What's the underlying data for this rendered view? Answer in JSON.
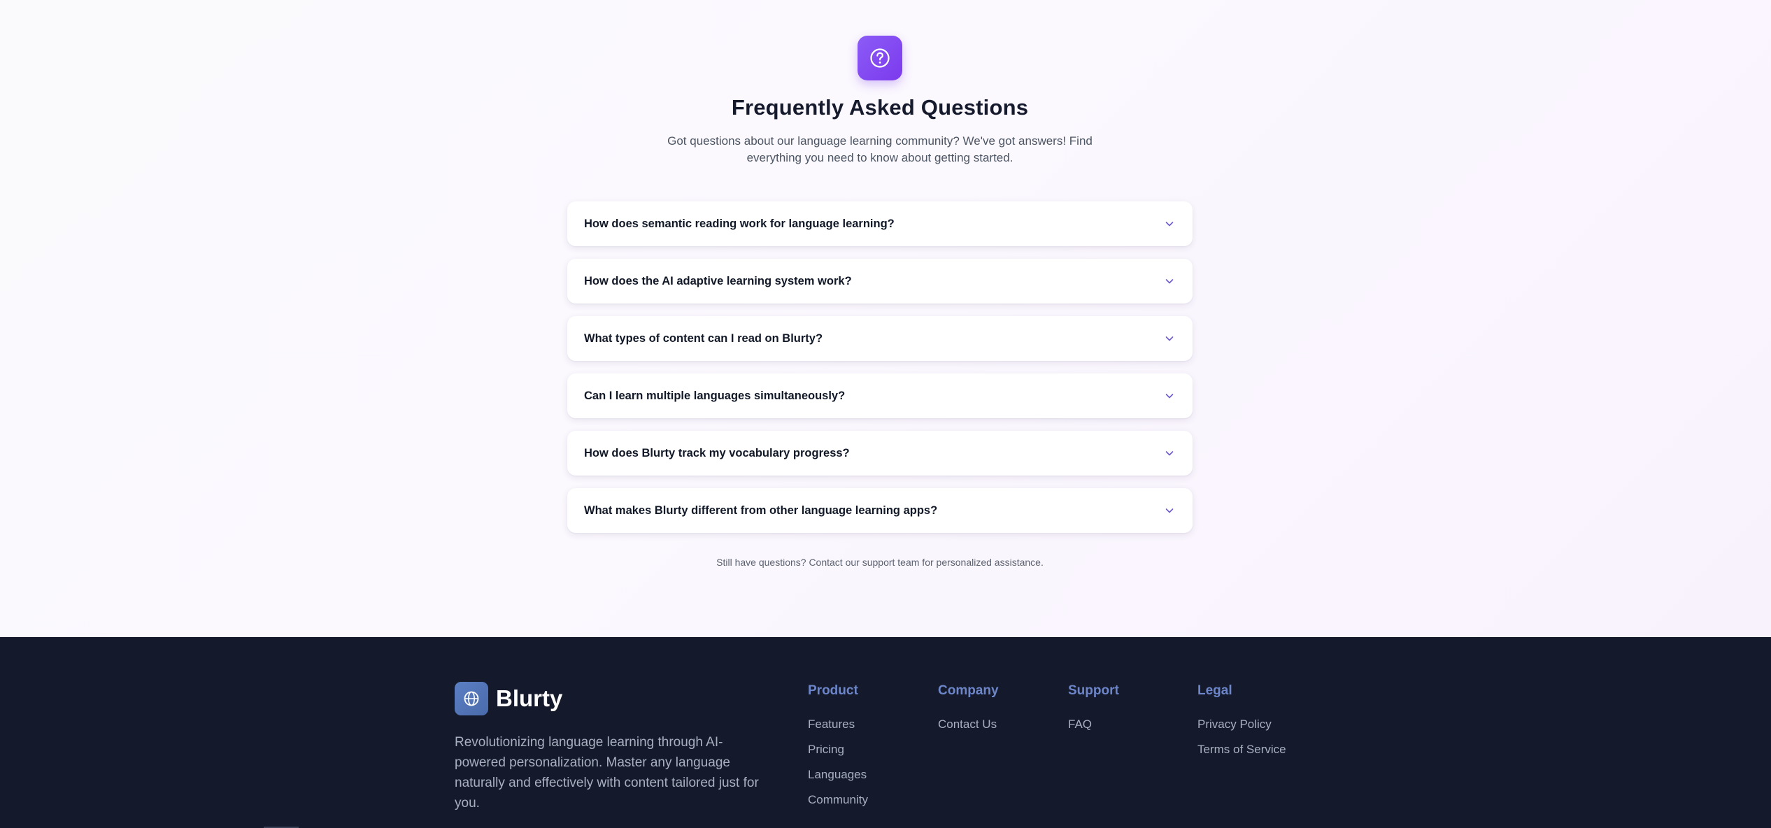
{
  "faq": {
    "icon": "question-circle-icon",
    "title": "Frequently Asked Questions",
    "subtitle": "Got questions about our language learning community? We've got answers! Find everything you need to know about getting started.",
    "items": [
      {
        "question": "How does semantic reading work for language learning?"
      },
      {
        "question": "How does the AI adaptive learning system work?"
      },
      {
        "question": "What types of content can I read on Blurty?"
      },
      {
        "question": "Can I learn multiple languages simultaneously?"
      },
      {
        "question": "How does Blurty track my vocabulary progress?"
      },
      {
        "question": "What makes Blurty different from other language learning apps?"
      }
    ],
    "footnote": "Still have questions? Contact our support team for personalized assistance."
  },
  "footer": {
    "brand": {
      "name": "Blurty",
      "icon": "globe-icon",
      "description": "Revolutionizing language learning through AI-powered personalization. Master any language naturally and effectively with content tailored just for you."
    },
    "columns": [
      {
        "title": "Product",
        "links": [
          "Features",
          "Pricing",
          "Languages",
          "Community"
        ]
      },
      {
        "title": "Company",
        "links": [
          "Contact Us"
        ]
      },
      {
        "title": "Support",
        "links": [
          "FAQ"
        ]
      },
      {
        "title": "Legal",
        "links": [
          "Privacy Policy",
          "Terms of Service"
        ]
      }
    ]
  },
  "colors": {
    "accent_purple": "#7c3aed",
    "footer_bg": "#141a2b",
    "footer_heading": "#6d85c9",
    "chevron": "#7c3aed"
  }
}
